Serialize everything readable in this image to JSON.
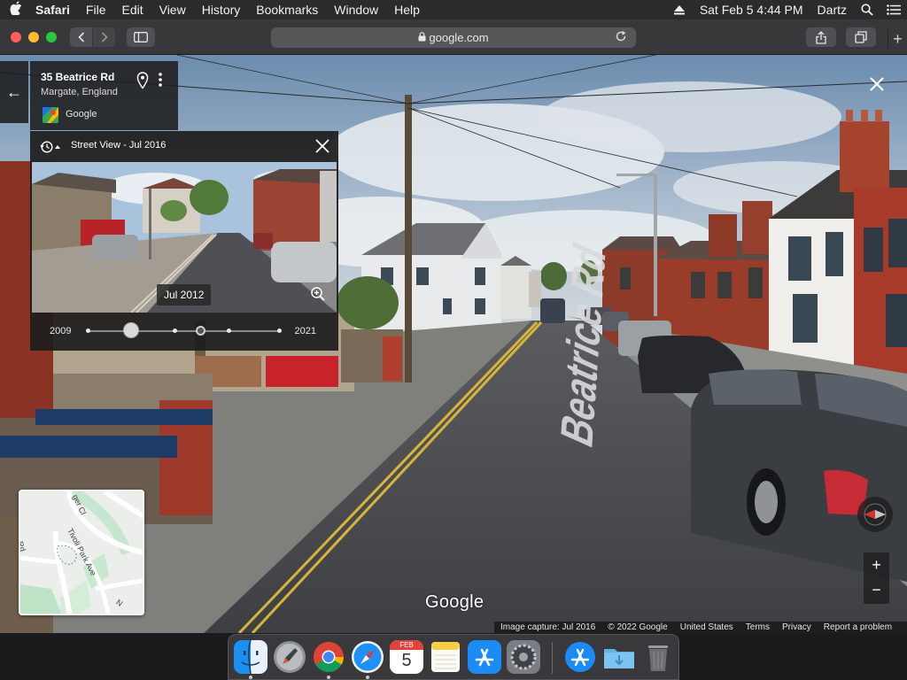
{
  "menubar": {
    "apple": "",
    "app": "Safari",
    "items": [
      "File",
      "Edit",
      "View",
      "History",
      "Bookmarks",
      "Window",
      "Help"
    ],
    "datetime": "Sat Feb 5  4:44 PM",
    "user": "Dartz"
  },
  "browser": {
    "url": "google.com",
    "new_tab": "+"
  },
  "place": {
    "title": "35 Beatrice Rd",
    "subtitle": "Margate, England",
    "source": "Google",
    "back": "←"
  },
  "timemachine": {
    "title": "Street View - Jul 2016",
    "preview_date": "Jul 2012",
    "start_year": "2009",
    "end_year": "2021"
  },
  "street_sign": "Beatrice Rd",
  "minimap": {
    "labels": [
      "Tivoli Park Ave",
      "Rd",
      "ger Cl",
      "N"
    ]
  },
  "zoom": {
    "in": "+",
    "out": "−"
  },
  "footer": {
    "wordmark": "Google",
    "links": [
      "Image capture: Jul 2016",
      "© 2022 Google",
      "United States",
      "Terms",
      "Privacy",
      "Report a problem"
    ]
  },
  "dock": {
    "calendar_month": "FEB",
    "calendar_day": "5"
  },
  "colors": {
    "menubar": "#2b2b2e",
    "toolbar": "#38383b",
    "panel": "#1c1c1c",
    "brick": "#9a3c2a",
    "garage_red": "#c8232a",
    "road_line": "#d9b43a"
  }
}
